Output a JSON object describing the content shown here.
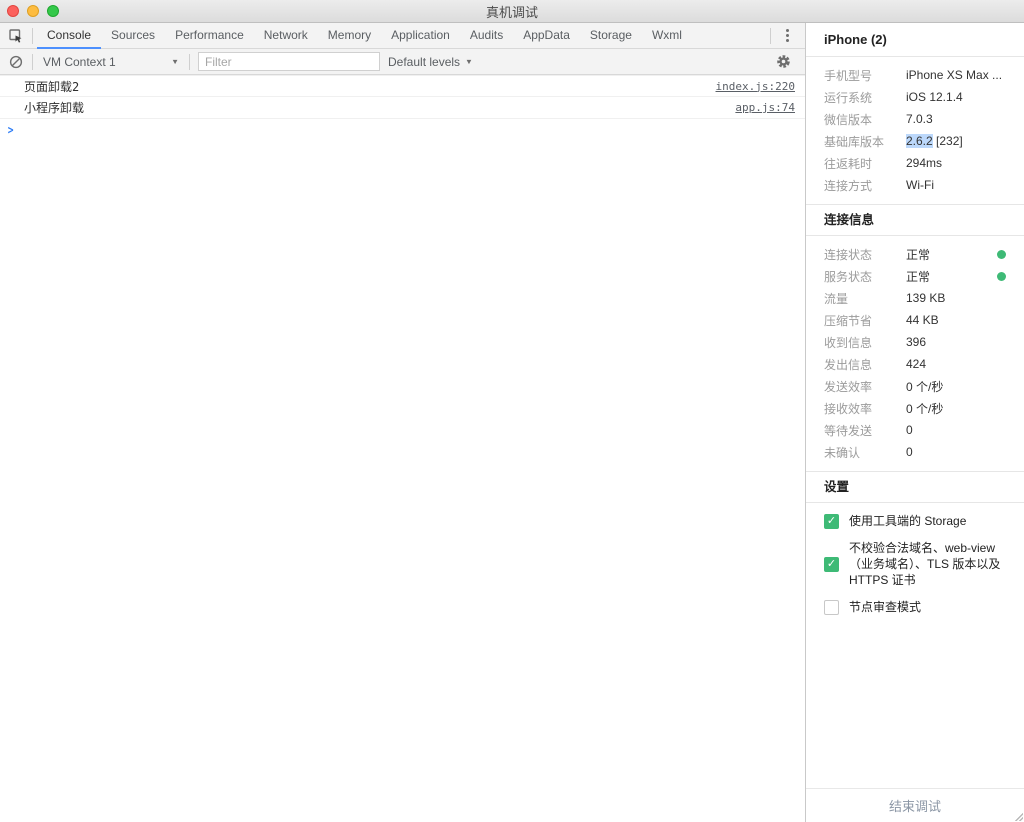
{
  "window": {
    "title": "真机调试"
  },
  "tabs": {
    "items": [
      {
        "label": "Console",
        "active": true
      },
      {
        "label": "Sources"
      },
      {
        "label": "Performance"
      },
      {
        "label": "Network"
      },
      {
        "label": "Memory"
      },
      {
        "label": "Application"
      },
      {
        "label": "Audits"
      },
      {
        "label": "AppData"
      },
      {
        "label": "Storage"
      },
      {
        "label": "Wxml"
      }
    ]
  },
  "toolbar": {
    "context_label": "VM Context 1",
    "filter_placeholder": "Filter",
    "levels_label": "Default levels"
  },
  "console": {
    "messages": [
      {
        "text": "页面卸载2",
        "source": "index.js:220"
      },
      {
        "text": "小程序卸载",
        "source": "app.js:74"
      }
    ],
    "prompt_symbol": ">"
  },
  "device_panel": {
    "title": "iPhone (2)",
    "info_rows": [
      {
        "label": "手机型号",
        "value": "iPhone XS Max ..."
      },
      {
        "label": "运行系统",
        "value": "iOS 12.1.4"
      },
      {
        "label": "微信版本",
        "value": "7.0.3"
      },
      {
        "label": "基础库版本",
        "value_highlight": "2.6.2",
        "value_rest": " [232]"
      },
      {
        "label": "往返耗时",
        "value": "294ms"
      },
      {
        "label": "连接方式",
        "value": "Wi-Fi"
      }
    ],
    "connection": {
      "title": "连接信息",
      "rows": [
        {
          "label": "连接状态",
          "value": "正常",
          "status_dot": true
        },
        {
          "label": "服务状态",
          "value": "正常",
          "status_dot": true
        },
        {
          "label": "流量",
          "value": "139 KB"
        },
        {
          "label": "压缩节省",
          "value": "44 KB"
        },
        {
          "label": "收到信息",
          "value": "396"
        },
        {
          "label": "发出信息",
          "value": "424"
        },
        {
          "label": "发送效率",
          "value": "0 个/秒"
        },
        {
          "label": "接收效率",
          "value": "0 个/秒"
        },
        {
          "label": "等待发送",
          "value": "0"
        },
        {
          "label": "未确认",
          "value": "0"
        }
      ]
    },
    "settings": {
      "title": "设置",
      "checkboxes": [
        {
          "label": "使用工具端的 Storage",
          "checked": true
        },
        {
          "label": "不校验合法域名、web-view（业务域名）、TLS 版本以及 HTTPS 证书",
          "checked": true
        },
        {
          "label": "节点审查模式",
          "checked": false
        }
      ],
      "check_glyph": "✓"
    },
    "footer": {
      "end_button_label": "结束调试"
    }
  },
  "colors": {
    "accent_blue": "#4d90fe",
    "wechat_green": "#3eba76",
    "selection_highlight": "#bcd8fb"
  },
  "icons": {
    "inspect": "inspect-element-cursor",
    "ban": "clear-console-ban",
    "gear": "settings-gear",
    "kebab": "more-vertical-dots",
    "chevron_down": "▼"
  }
}
